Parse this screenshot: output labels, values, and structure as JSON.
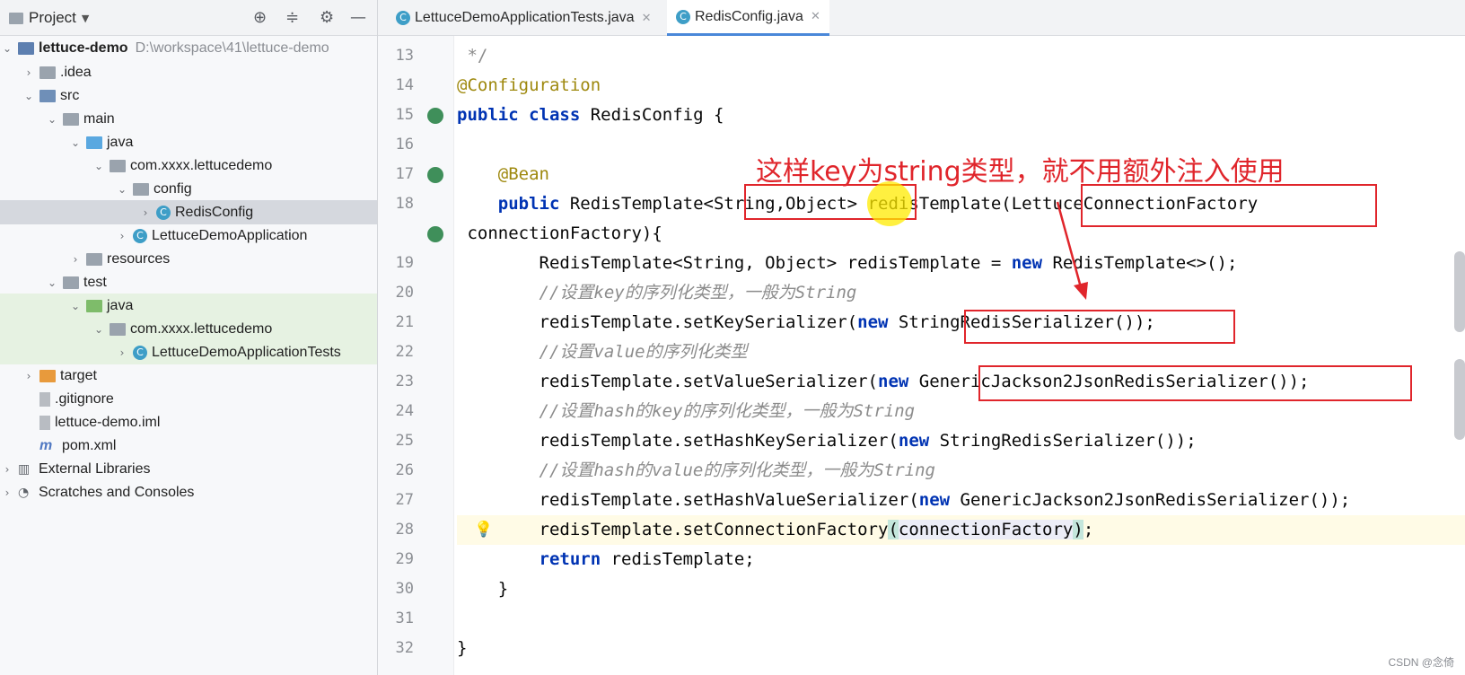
{
  "project_panel": {
    "title": "Project",
    "tree": [
      {
        "label": "lettuce-demo",
        "path": "D:\\workspace\\41\\lettuce-demo"
      },
      {
        "label": ".idea"
      },
      {
        "label": "src"
      },
      {
        "label": "main"
      },
      {
        "label": "java"
      },
      {
        "label": "com.xxxx.lettucedemo"
      },
      {
        "label": "config"
      },
      {
        "label": "RedisConfig"
      },
      {
        "label": "LettuceDemoApplication"
      },
      {
        "label": "resources"
      },
      {
        "label": "test"
      },
      {
        "label": "java"
      },
      {
        "label": "com.xxxx.lettucedemo"
      },
      {
        "label": "LettuceDemoApplicationTests"
      },
      {
        "label": "target"
      },
      {
        "label": ".gitignore"
      },
      {
        "label": "lettuce-demo.iml"
      },
      {
        "label": "pom.xml"
      },
      {
        "label": "External Libraries"
      },
      {
        "label": "Scratches and Consoles"
      }
    ]
  },
  "editor": {
    "tabs": [
      {
        "label": "LettuceDemoApplicationTests.java"
      },
      {
        "label": "RedisConfig.java"
      }
    ],
    "line_numbers": [
      "13",
      "14",
      "15",
      "16",
      "17",
      "18",
      "",
      "19",
      "20",
      "21",
      "22",
      "23",
      "24",
      "25",
      "26",
      "27",
      "28",
      "29",
      "30",
      "31",
      "32"
    ],
    "code": {
      "l13": " */",
      "l14": "@Configuration",
      "l15a": "public class",
      "l15b": " RedisConfig {",
      "l17": "    @Bean",
      "l18a": "    public",
      "l18b": " RedisTemplate<String,Object> redisTemplate(LettuceConnectionFactory",
      "l18c": " connectionFactory){",
      "l19a": "        RedisTemplate<String, Object> redisTemplate = ",
      "l19b": "new",
      "l19c": " RedisTemplate<>();",
      "l20": "        //设置key的序列化类型，一般为String",
      "l21a": "        redisTemplate.setKeySerializer(",
      "l21b": "new",
      "l21c": " StringRedisSerializer());",
      "l22": "        //设置value的序列化类型",
      "l23a": "        redisTemplate.setValueSerializer(",
      "l23b": "new",
      "l23c": " GenericJackson2JsonRedisSerializer());",
      "l24": "        //设置hash的key的序列化类型，一般为String",
      "l25a": "        redisTemplate.setHashKeySerializer(",
      "l25b": "new",
      "l25c": " StringRedisSerializer());",
      "l26": "        //设置hash的value的序列化类型，一般为String",
      "l27a": "        redisTemplate.setHashValueSerializer(",
      "l27b": "new",
      "l27c": " GenericJackson2JsonRedisSerializer());",
      "l28a": "        redisTemplate.setConnectionFactory",
      "l28b": "(",
      "l28c": "connectionFactory",
      "l28d": ")",
      "l28e": ";",
      "l29a": "        return",
      "l29b": " redisTemplate;",
      "l30": "    }",
      "l32": "}"
    }
  },
  "annotation": {
    "text": "这样key为string类型，就不用额外注入使用",
    "color": "#e0252b"
  },
  "watermark": "CSDN @念倚"
}
